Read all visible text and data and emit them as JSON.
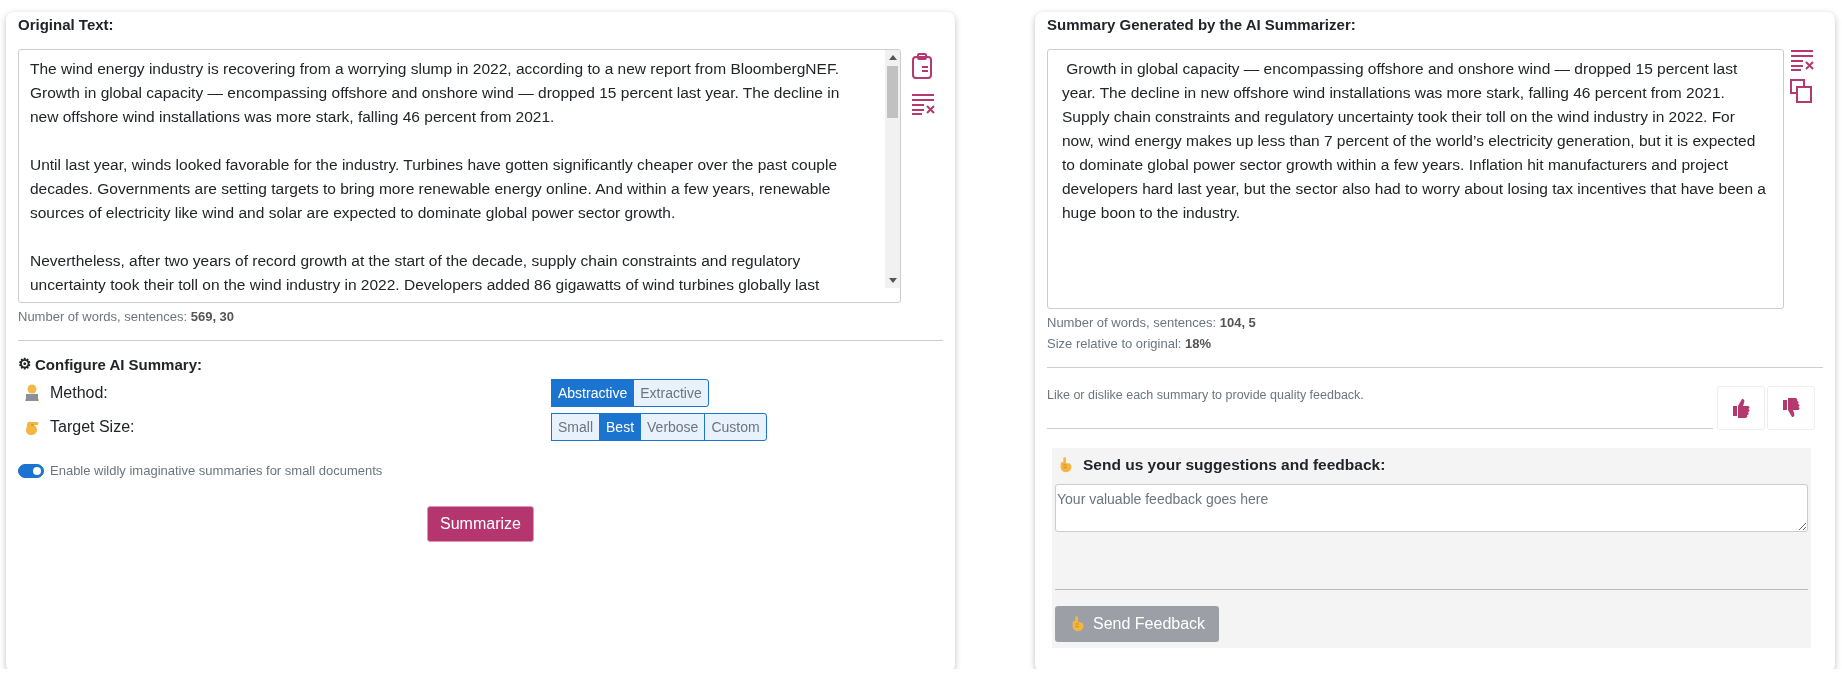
{
  "original": {
    "label": "Original Text:",
    "paragraphs": [
      "The wind energy industry is recovering from a worrying slump in 2022, according to a new report from BloombergNEF. Growth in global capacity — encompassing offshore and onshore wind — dropped 15 percent last year. The decline in new offshore wind installations was more stark, falling 46 percent from 2021.",
      "Until last year, winds looked favorable for the industry. Turbines have gotten significantly cheaper over the past couple decades. Governments are setting targets to bring more renewable energy online. And within a few years, renewable sources of electricity like wind and solar are expected to dominate global power sector growth.",
      "Nevertheless, after two years of record growth at the start of the decade, supply chain constraints and regulatory uncertainty took their toll on the wind industry in 2022. Developers added 86 gigawatts of wind turbines globally last"
    ],
    "stats": [
      {
        "label": "Number of words, sentences:",
        "value": "569, 30"
      }
    ]
  },
  "configure": {
    "icon": "⚙",
    "title": "Configure AI Summary:",
    "settings": [
      {
        "label": "Method:",
        "options": [
          {
            "label": "Abstractive",
            "selected": true
          },
          {
            "label": "Extractive",
            "selected": false
          }
        ]
      },
      {
        "label": "Target Size:",
        "options": [
          {
            "label": "Small",
            "selected": false
          },
          {
            "label": "Best",
            "selected": true
          },
          {
            "label": "Verbose",
            "selected": false
          },
          {
            "label": "Custom",
            "selected": false
          }
        ]
      }
    ],
    "toggle": {
      "label": "Enable wildly imaginative summaries for small documents",
      "on": true
    }
  },
  "summarize_button": {
    "label": "Summarize"
  },
  "summary": {
    "label": "Summary Generated by the AI Summarizer:",
    "text": " Growth in global capacity — encompassing offshore and onshore wind — dropped 15 percent last year. The decline in new offshore wind installations was more stark, falling 46 percent from 2021. Supply chain constraints and regulatory uncertainty took their toll on the wind industry in 2022. For now, wind energy makes up less than 7 percent of the world’s electricity generation, but it is expected to dominate global power sector growth within a few years. Inflation hit manufacturers and project developers hard last year, but the sector also had to worry about losing tax incentives that have been a huge boon to the industry.",
    "stats": [
      {
        "label": "Number of words, sentences:",
        "value": "104, 5"
      },
      {
        "label": "Size relative to original:",
        "value": "18%"
      }
    ]
  },
  "rating": {
    "prompt": "Like or dislike each summary to provide quality feedback."
  },
  "feedback": {
    "heading": "Send us your suggestions and feedback:",
    "placeholder": "Your valuable feedback goes here",
    "button": {
      "label": "Send Feedback",
      "disabled": true
    }
  }
}
